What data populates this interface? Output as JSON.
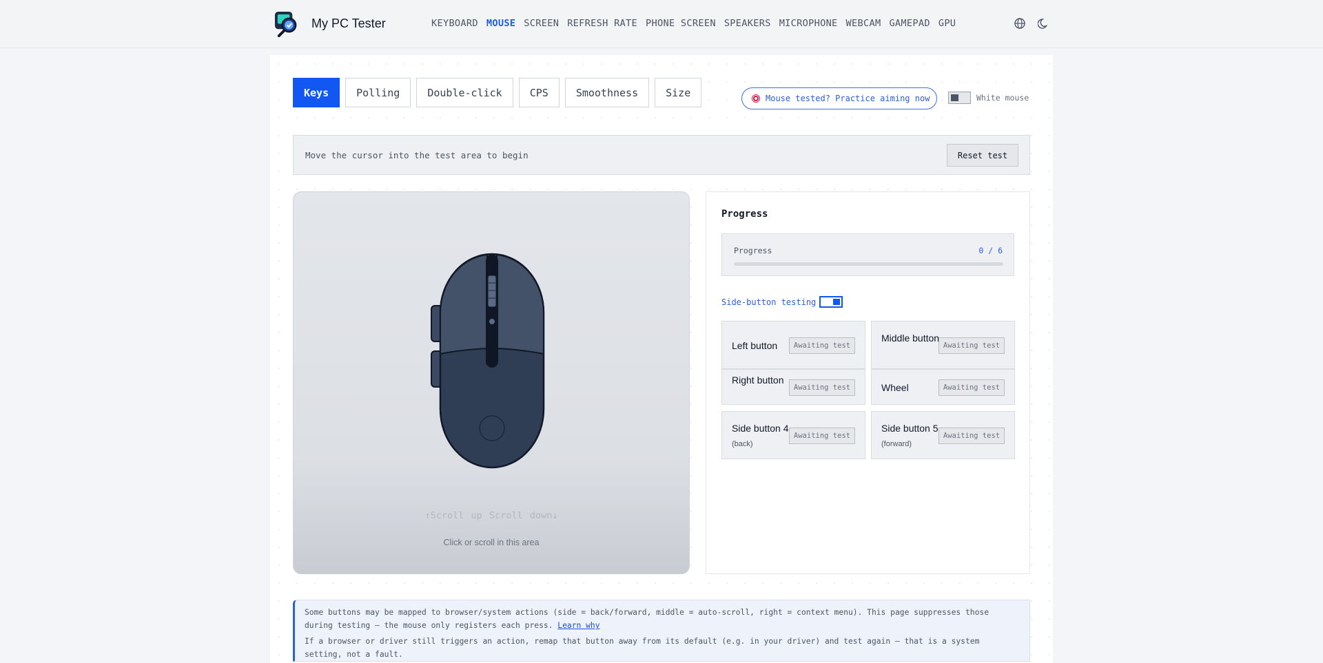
{
  "header": {
    "brand": "My PC Tester",
    "nav": [
      "KEYBOARD",
      "MOUSE",
      "SCREEN",
      "REFRESH RATE",
      "PHONE SCREEN",
      "SPEAKERS",
      "MICROPHONE",
      "WEBCAM",
      "GAMEPAD",
      "GPU"
    ],
    "active_nav": "MOUSE",
    "icons": [
      "globe-icon",
      "moon-icon"
    ]
  },
  "tabs": [
    "Keys",
    "Polling",
    "Double-click",
    "CPS",
    "Smoothness",
    "Size"
  ],
  "active_tab": "Keys",
  "practice_link": "Mouse tested? Practice aiming now",
  "white_mouse_label": "White mouse",
  "white_mouse_enabled": false,
  "status": {
    "message": "Move the cursor into the test area to begin",
    "reset_label": "Reset test"
  },
  "test_area": {
    "scroll_up": "↑Scroll up",
    "scroll_down": "Scroll down↓",
    "hint": "Click or scroll in this area"
  },
  "progress": {
    "title": "Progress",
    "label": "Progress",
    "count_text": "0 / 6",
    "done": 0,
    "total": 6
  },
  "side_button_testing": {
    "label": "Side-button testing",
    "enabled": true
  },
  "buttons": [
    {
      "name": "Left button",
      "note": "",
      "status": "Awaiting test"
    },
    {
      "name": "Middle button",
      "note": "",
      "status": "Awaiting test"
    },
    {
      "name": "Right button",
      "note": "",
      "status": "Awaiting test"
    },
    {
      "name": "Wheel",
      "note": "",
      "status": "Awaiting test"
    },
    {
      "name": "Side button 4",
      "note": "(back)",
      "status": "Awaiting test"
    },
    {
      "name": "Side button 5",
      "note": "(forward)",
      "status": "Awaiting test"
    }
  ],
  "notice": {
    "line1": "Some buttons may be mapped to browser/system actions (side = back/forward, middle = auto-scroll, right = context menu). This page suppresses those during testing — the mouse only registers each press.",
    "learn_why": "Learn why",
    "line2": "If a browser or driver still triggers an action, remap that button away from its default (e.g. in your driver) and test again — that is a system setting, not a fault."
  },
  "colors": {
    "accent": "#1257f2",
    "mouse_body": "#2f3d55",
    "mouse_top": "#435269"
  }
}
